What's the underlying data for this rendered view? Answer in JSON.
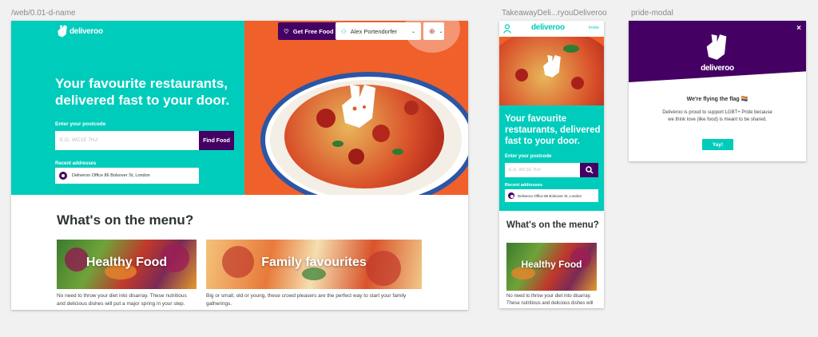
{
  "frames": {
    "desktop_label": "/web/0.01-d-name",
    "mobile_label": "TakeawayDeli...ryouDeliveroo",
    "modal_label": "pride-modal"
  },
  "colors": {
    "teal": "#00ccbc",
    "purple": "#440063",
    "orange": "#f0602a"
  },
  "brand": {
    "logo_text": "deliveroo"
  },
  "desktop": {
    "get_free_food": "Get Free Food",
    "user_name": "Alex Portendorfer",
    "headline": "Your favourite restaurants, delivered fast to your door.",
    "postcode_label": "Enter your postcode",
    "postcode_placeholder": "E.G. WC1E 7HJ",
    "find_food": "Find Food",
    "recent_label": "Recent addresses",
    "recent_address": "Deliveroo Office 86 Bolsover St, London",
    "menu_title": "What's on the menu?",
    "cards": [
      {
        "title": "Healthy Food",
        "desc": "No need to throw your diet into disarray. These nutritious and delicious dishes will put a major spring in your step."
      },
      {
        "title": "Family favourites",
        "desc": "Big or small, old or young, these crowd pleasers are the perfect way to start your family gatherings."
      }
    ]
  },
  "mobile": {
    "menu_link": "Invite",
    "headline": "Your favourite restaurants, delivered fast to your door.",
    "postcode_label": "Enter your postcode",
    "postcode_placeholder": "E.G. WC1E 7HJ",
    "recent_label": "Recent addresses",
    "recent_address": "Deliveroo Office 86 Bolsover St, London",
    "menu_title": "What's on the menu?",
    "card_title": "Healthy Food",
    "card_desc": "No need to throw your diet into disarray. These nutritious and delicious dishes will put a major spring"
  },
  "modal": {
    "close": "×",
    "title": "We're flying the flag 🏳️‍🌈",
    "body": "Deliveroo is proud to support LGBT+ Pride because we think love (like food) is meant to be shared.",
    "button": "Yay!"
  }
}
